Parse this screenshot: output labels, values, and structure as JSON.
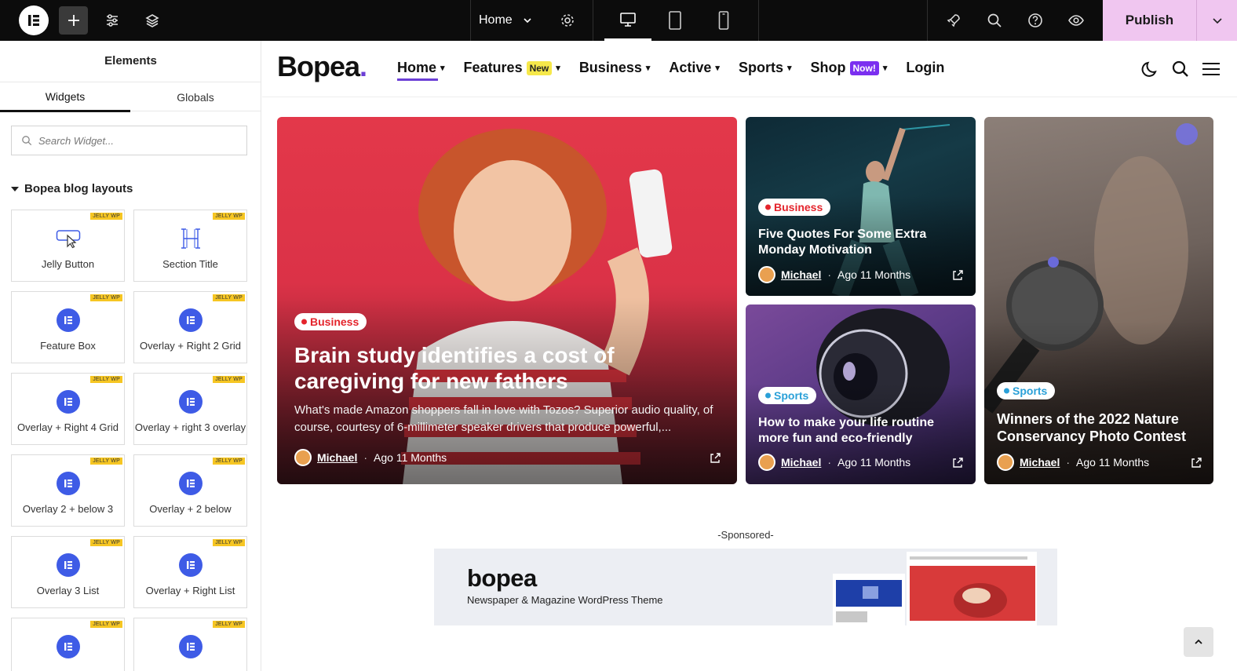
{
  "topbar": {
    "page_selector": "Home",
    "publish_label": "Publish"
  },
  "panel": {
    "title": "Elements",
    "tabs": [
      {
        "label": "Widgets"
      },
      {
        "label": "Globals"
      }
    ],
    "search_placeholder": "Search Widget...",
    "category": "Bopea blog layouts",
    "badge": "JELLY WP",
    "widgets": [
      {
        "label": "Jelly Button",
        "icon": "cursor-button-icon"
      },
      {
        "label": "Section Title",
        "icon": "heading-icon"
      },
      {
        "label": "Feature Box",
        "icon": "elementor-icon"
      },
      {
        "label": "Overlay + Right 2 Grid",
        "icon": "elementor-icon"
      },
      {
        "label": "Overlay + Right 4 Grid",
        "icon": "elementor-icon"
      },
      {
        "label": "Overlay + right 3 overlay",
        "icon": "elementor-icon"
      },
      {
        "label": "Overlay 2 + below 3",
        "icon": "elementor-icon"
      },
      {
        "label": "Overlay + 2 below",
        "icon": "elementor-icon"
      },
      {
        "label": "Overlay 3 List",
        "icon": "elementor-icon"
      },
      {
        "label": "Overlay + Right List",
        "icon": "elementor-icon"
      },
      {
        "label": "",
        "icon": "elementor-icon"
      },
      {
        "label": "",
        "icon": "elementor-icon"
      }
    ]
  },
  "site": {
    "brand": "Bopea",
    "brand_dot": ".",
    "nav": [
      {
        "label": "Home",
        "pill": ""
      },
      {
        "label": "Features",
        "pill": "New"
      },
      {
        "label": "Business",
        "pill": ""
      },
      {
        "label": "Active",
        "pill": ""
      },
      {
        "label": "Sports",
        "pill": ""
      },
      {
        "label": "Shop",
        "pill": "Now!"
      },
      {
        "label": "Login",
        "pill": ""
      }
    ]
  },
  "posts": {
    "main": {
      "category": "Business",
      "title": "Brain study identifies a cost of caregiving for new fathers",
      "excerpt": "What's made Amazon shoppers fall in love with Tozos? Superior audio quality, of course, courtesy of 6-millimeter speaker drivers that produce powerful,...",
      "author": "Michael",
      "date": "Ago 11 Months"
    },
    "top_right": {
      "category": "Business",
      "title": "Five Quotes For Some Extra Monday Motivation",
      "author": "Michael",
      "date": "Ago 11 Months"
    },
    "bottom_right": {
      "category": "Sports",
      "title": "How to make your life routine more fun and eco-friendly",
      "author": "Michael",
      "date": "Ago 11 Months"
    },
    "tall": {
      "category": "Sports",
      "title": "Winners of the 2022 Nature Conservancy Photo Contest",
      "author": "Michael",
      "date": "Ago 11 Months"
    }
  },
  "sponsored": {
    "label": "-Sponsored-",
    "ad_brand": "bopea",
    "ad_tagline": "Newspaper & Magazine WordPress Theme"
  },
  "colors": {
    "business": "#e4242c",
    "sports": "#2aa0d8",
    "accent": "#6b3fd6",
    "publish": "#f0c6f0"
  }
}
